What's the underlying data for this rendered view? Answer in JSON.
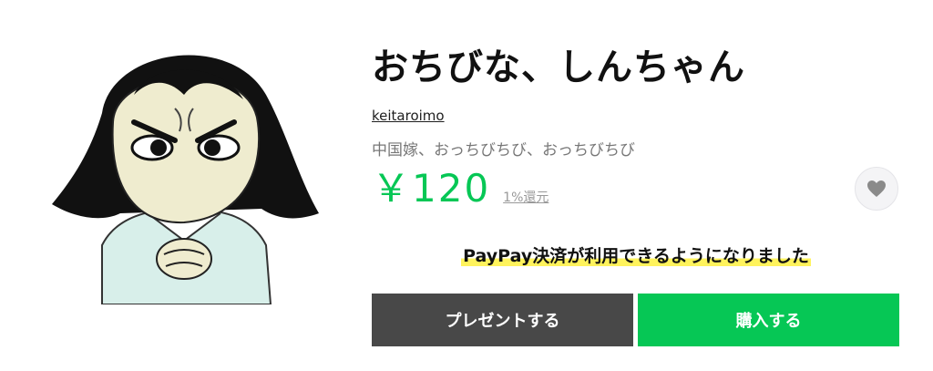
{
  "product": {
    "title": "おちびな、しんちゃん",
    "author": "keitaroimo",
    "description": "中国嫁、おっちびちび、おっちびちび",
    "price": "￥120",
    "points_label": "1%還元"
  },
  "notice": {
    "paypay_text": "PayPay決済が利用できるようになりました"
  },
  "actions": {
    "gift_label": "プレゼントする",
    "buy_label": "購入する"
  },
  "icons": {
    "favorite": "heart-icon"
  },
  "colors": {
    "brand_green": "#06c755",
    "gift_button": "#484848",
    "highlight": "#fff35c"
  }
}
